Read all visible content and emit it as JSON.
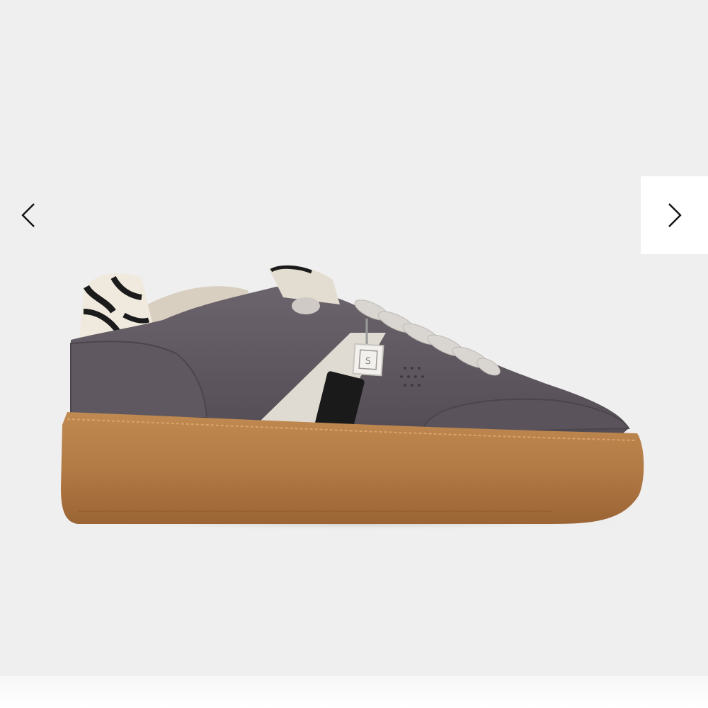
{
  "gallery": {
    "prev_icon": "chevron-left-icon",
    "next_icon": "chevron-right-icon",
    "background_color": "#efefef",
    "button_background": "#ffffff"
  },
  "product": {
    "image_alt": "",
    "tag_letter": "S",
    "colors": {
      "suede": "#5c555d",
      "sole": "#b27a45",
      "laces": "#d9d6d1",
      "panel": "#e0dbd2"
    }
  }
}
